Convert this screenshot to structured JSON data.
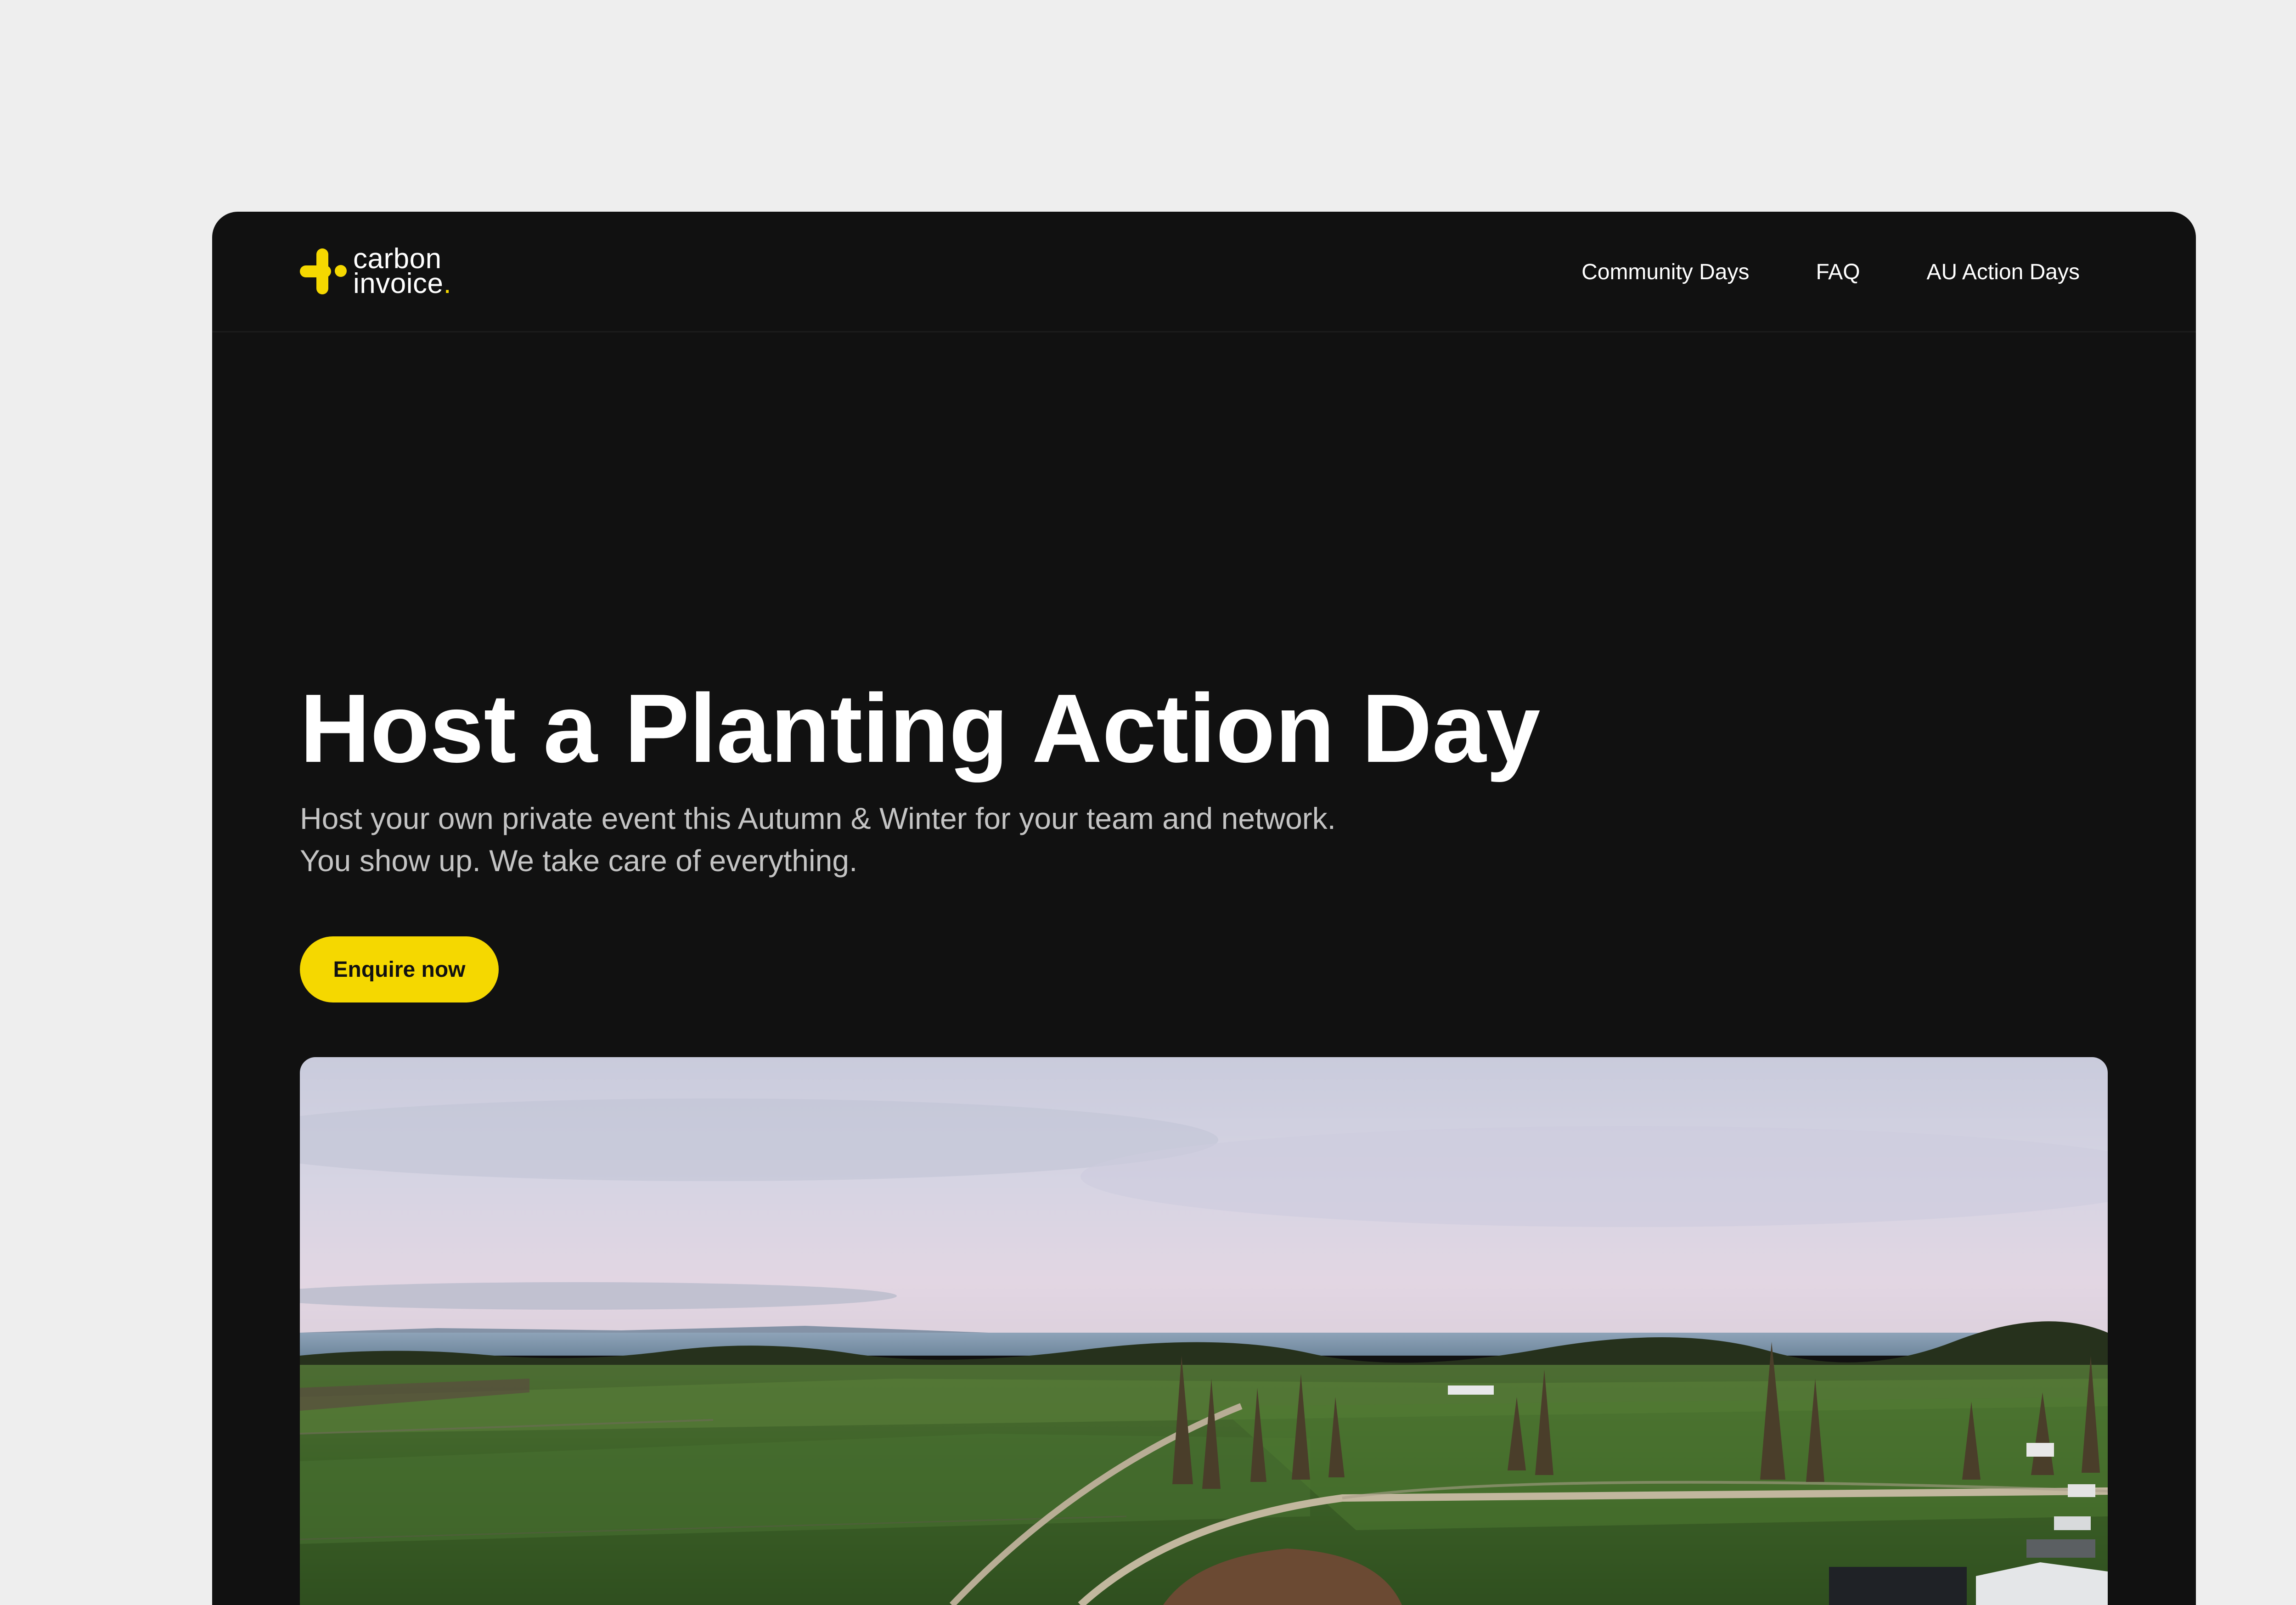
{
  "brand": {
    "line1": "carbon",
    "line2": "invoice",
    "accent_color": "#f5d800"
  },
  "nav": {
    "items": [
      {
        "label": "Community Days"
      },
      {
        "label": "FAQ"
      },
      {
        "label": "AU Action Days"
      }
    ]
  },
  "hero": {
    "title": "Host a Planting Action Day",
    "subtitle_line1": "Host your own private event this Autumn & Winter for your team and network.",
    "subtitle_line2": "You show up. We take care of everything.",
    "cta_label": "Enquire now"
  },
  "colors": {
    "page_background": "#eeeeee",
    "window_background": "#111111",
    "accent": "#f5d800"
  }
}
